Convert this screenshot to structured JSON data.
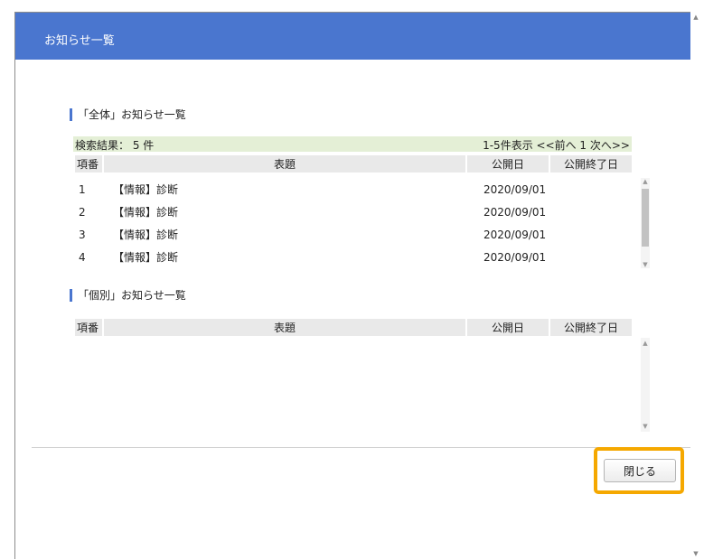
{
  "window": {
    "title": "お知らせ一覧"
  },
  "general": {
    "heading": "「全体」お知らせ一覧",
    "result_count": "検索結果： 5 件",
    "pager": "1-5件表示 <<前へ 1 次へ>>",
    "columns": [
      "項番",
      "表題",
      "公開日",
      "公開終了日"
    ],
    "rows": [
      {
        "no": "1",
        "title": "【情報】診断",
        "date": "2020/09/01",
        "end": ""
      },
      {
        "no": "2",
        "title": "【情報】診断",
        "date": "2020/09/01",
        "end": ""
      },
      {
        "no": "3",
        "title": "【情報】診断",
        "date": "2020/09/01",
        "end": ""
      },
      {
        "no": "4",
        "title": "【情報】診断",
        "date": "2020/09/01",
        "end": ""
      }
    ]
  },
  "individual": {
    "heading": "「個別」お知らせ一覧",
    "columns": [
      "項番",
      "表題",
      "公開日",
      "公開終了日"
    ],
    "rows": []
  },
  "footer": {
    "close_label": "閉じる"
  },
  "colors": {
    "titlebar": "#4a76cf",
    "result_bg": "#e4efd6",
    "highlight": "#f5a800"
  }
}
